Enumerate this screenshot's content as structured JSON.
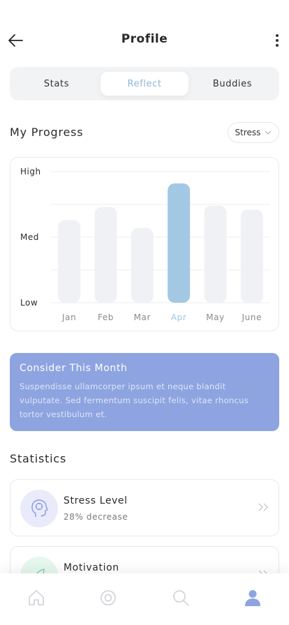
{
  "header": {
    "title": "Profile"
  },
  "tabs": [
    {
      "label": "Stats",
      "active": false
    },
    {
      "label": "Reflect",
      "active": true
    },
    {
      "label": "Buddies",
      "active": false
    }
  ],
  "progress": {
    "title": "My Progress",
    "filter": {
      "selected": "Stress"
    }
  },
  "chart_data": {
    "type": "bar",
    "categories": [
      "Jan",
      "Feb",
      "Mar",
      "Apr",
      "May",
      "June"
    ],
    "values": [
      0.63,
      0.73,
      0.57,
      0.91,
      0.74,
      0.71
    ],
    "y_tick_labels": [
      "High",
      "Med",
      "Low"
    ],
    "ylim": [
      0,
      1
    ],
    "highlight_index": 3,
    "grid": true,
    "colors": {
      "bar": "#eff1f4",
      "highlight": "#a3c8e3",
      "highlight_label": "#9fc6e6",
      "label": "#8a8a8a"
    }
  },
  "consider": {
    "title": "Consider This Month",
    "body": "Suspendisse ullamcorper ipsum et neque blandit vulputate. Sed fermentum suscipit felis, vitae rhoncus tortor vestibulum et."
  },
  "statistics": {
    "title": "Statistics",
    "items": [
      {
        "name": "Stress Level",
        "sub": "28% decrease",
        "icon": "head-icon",
        "color": "#e9ebfb"
      },
      {
        "name": "Motivation",
        "sub": "",
        "icon": "leaf-icon",
        "color": "#e6f7ee"
      }
    ]
  },
  "nav": {
    "items": [
      "home-icon",
      "target-icon",
      "search-icon",
      "profile-icon"
    ],
    "active": "profile-icon"
  },
  "colors": {
    "accent": "#8fb7d9",
    "card": "#8da4e0"
  }
}
